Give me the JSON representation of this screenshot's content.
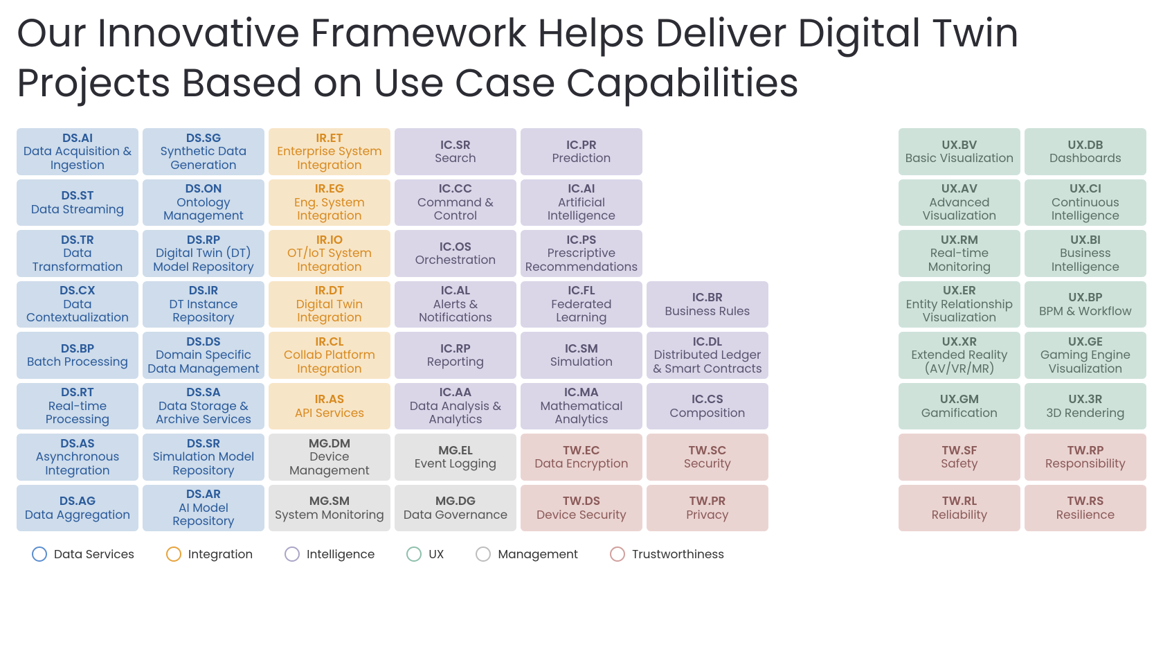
{
  "title": "Our Innovative Framework Helps Deliver Digital Twin Projects Based on Use Case Capabilities",
  "categories": {
    "ds": "Data Services",
    "ir": "Integration",
    "ic": "Intelligence",
    "ux": "UX",
    "mg": "Management",
    "tw": "Trustworthiness"
  },
  "grid": [
    [
      {
        "cat": "ds",
        "code": "DS.AI",
        "label": "Data Acquisition & Ingestion"
      },
      {
        "cat": "ds",
        "code": "DS.SG",
        "label": "Synthetic Data Generation"
      },
      {
        "cat": "ir",
        "code": "IR.ET",
        "label": "Enterprise System Integration"
      },
      {
        "cat": "ic",
        "code": "IC.SR",
        "label": "Search"
      },
      {
        "cat": "ic",
        "code": "IC.PR",
        "label": "Prediction"
      },
      null,
      null,
      {
        "cat": "ux",
        "code": "UX.BV",
        "label": "Basic Visualization"
      },
      {
        "cat": "ux",
        "code": "UX.DB",
        "label": "Dashboards"
      }
    ],
    [
      {
        "cat": "ds",
        "code": "DS.ST",
        "label": "Data Streaming"
      },
      {
        "cat": "ds",
        "code": "DS.ON",
        "label": "Ontology Management"
      },
      {
        "cat": "ir",
        "code": "IR.EG",
        "label": "Eng. System Integration"
      },
      {
        "cat": "ic",
        "code": "IC.CC",
        "label": "Command & Control"
      },
      {
        "cat": "ic",
        "code": "IC.AI",
        "label": "Artificial Intelligence"
      },
      null,
      null,
      {
        "cat": "ux",
        "code": "UX.AV",
        "label": "Advanced Visualization"
      },
      {
        "cat": "ux",
        "code": "UX.CI",
        "label": "Continuous Intelligence"
      }
    ],
    [
      {
        "cat": "ds",
        "code": "DS.TR",
        "label": "Data Transformation"
      },
      {
        "cat": "ds",
        "code": "DS.RP",
        "label": "Digital Twin (DT) Model Repository"
      },
      {
        "cat": "ir",
        "code": "IR.IO",
        "label": "OT/IoT System Integration"
      },
      {
        "cat": "ic",
        "code": "IC.OS",
        "label": "Orchestration"
      },
      {
        "cat": "ic",
        "code": "IC.PS",
        "label": "Prescriptive Recommendations"
      },
      null,
      null,
      {
        "cat": "ux",
        "code": "UX.RM",
        "label": "Real-time Monitoring"
      },
      {
        "cat": "ux",
        "code": "UX.BI",
        "label": "Business Intelligence"
      }
    ],
    [
      {
        "cat": "ds",
        "code": "DS.CX",
        "label": "Data Contextualization"
      },
      {
        "cat": "ds",
        "code": "DS.IR",
        "label": "DT Instance Repository"
      },
      {
        "cat": "ir",
        "code": "IR.DT",
        "label": "Digital Twin Integration"
      },
      {
        "cat": "ic",
        "code": "IC.AL",
        "label": "Alerts & Notifications"
      },
      {
        "cat": "ic",
        "code": "IC.FL",
        "label": "Federated Learning"
      },
      {
        "cat": "ic",
        "code": "IC.BR",
        "label": "Business Rules"
      },
      null,
      {
        "cat": "ux",
        "code": "UX.ER",
        "label": "Entity Relationship Visualization"
      },
      {
        "cat": "ux",
        "code": "UX.BP",
        "label": "BPM & Workflow"
      }
    ],
    [
      {
        "cat": "ds",
        "code": "DS.BP",
        "label": "Batch Processing"
      },
      {
        "cat": "ds",
        "code": "DS.DS",
        "label": "Domain Specific Data Management"
      },
      {
        "cat": "ir",
        "code": "IR.CL",
        "label": "Collab Platform Integration"
      },
      {
        "cat": "ic",
        "code": "IC.RP",
        "label": "Reporting"
      },
      {
        "cat": "ic",
        "code": "IC.SM",
        "label": "Simulation"
      },
      {
        "cat": "ic",
        "code": "IC.DL",
        "label": "Distributed Ledger & Smart Contracts"
      },
      null,
      {
        "cat": "ux",
        "code": "UX.XR",
        "label": "Extended Reality (AV/VR/MR)"
      },
      {
        "cat": "ux",
        "code": "UX.GE",
        "label": "Gaming Engine Visualization"
      }
    ],
    [
      {
        "cat": "ds",
        "code": "DS.RT",
        "label": "Real-time Processing"
      },
      {
        "cat": "ds",
        "code": "DS.SA",
        "label": "Data Storage & Archive Services"
      },
      {
        "cat": "ir",
        "code": "IR.AS",
        "label": "API Services"
      },
      {
        "cat": "ic",
        "code": "IC.AA",
        "label": "Data Analysis & Analytics"
      },
      {
        "cat": "ic",
        "code": "IC.MA",
        "label": "Mathematical Analytics"
      },
      {
        "cat": "ic",
        "code": "IC.CS",
        "label": "Composition"
      },
      null,
      {
        "cat": "ux",
        "code": "UX.GM",
        "label": "Gamification"
      },
      {
        "cat": "ux",
        "code": "UX.3R",
        "label": "3D Rendering"
      }
    ],
    [
      {
        "cat": "ds",
        "code": "DS.AS",
        "label": "Asynchronous Integration"
      },
      {
        "cat": "ds",
        "code": "DS.SR",
        "label": "Simulation Model Repository"
      },
      {
        "cat": "mg",
        "code": "MG.DM",
        "label": "Device Management"
      },
      {
        "cat": "mg",
        "code": "MG.EL",
        "label": "Event Logging"
      },
      {
        "cat": "tw",
        "code": "TW.EC",
        "label": "Data Encryption"
      },
      {
        "cat": "tw",
        "code": "TW.SC",
        "label": "Security"
      },
      null,
      {
        "cat": "tw",
        "code": "TW.SF",
        "label": "Safety"
      },
      {
        "cat": "tw",
        "code": "TW.RP",
        "label": "Responsibility"
      }
    ],
    [
      {
        "cat": "ds",
        "code": "DS.AG",
        "label": "Data Aggregation"
      },
      {
        "cat": "ds",
        "code": "DS.AR",
        "label": "AI Model Repository"
      },
      {
        "cat": "mg",
        "code": "MG.SM",
        "label": "System Monitoring"
      },
      {
        "cat": "mg",
        "code": "MG.DG",
        "label": "Data Governance"
      },
      {
        "cat": "tw",
        "code": "TW.DS",
        "label": "Device Security"
      },
      {
        "cat": "tw",
        "code": "TW.PR",
        "label": "Privacy"
      },
      null,
      {
        "cat": "tw",
        "code": "TW.RL",
        "label": "Reliability"
      },
      {
        "cat": "tw",
        "code": "TW.RS",
        "label": "Resilience"
      }
    ]
  ],
  "legend_order": [
    "ds",
    "ir",
    "ic",
    "ux",
    "mg",
    "tw"
  ]
}
